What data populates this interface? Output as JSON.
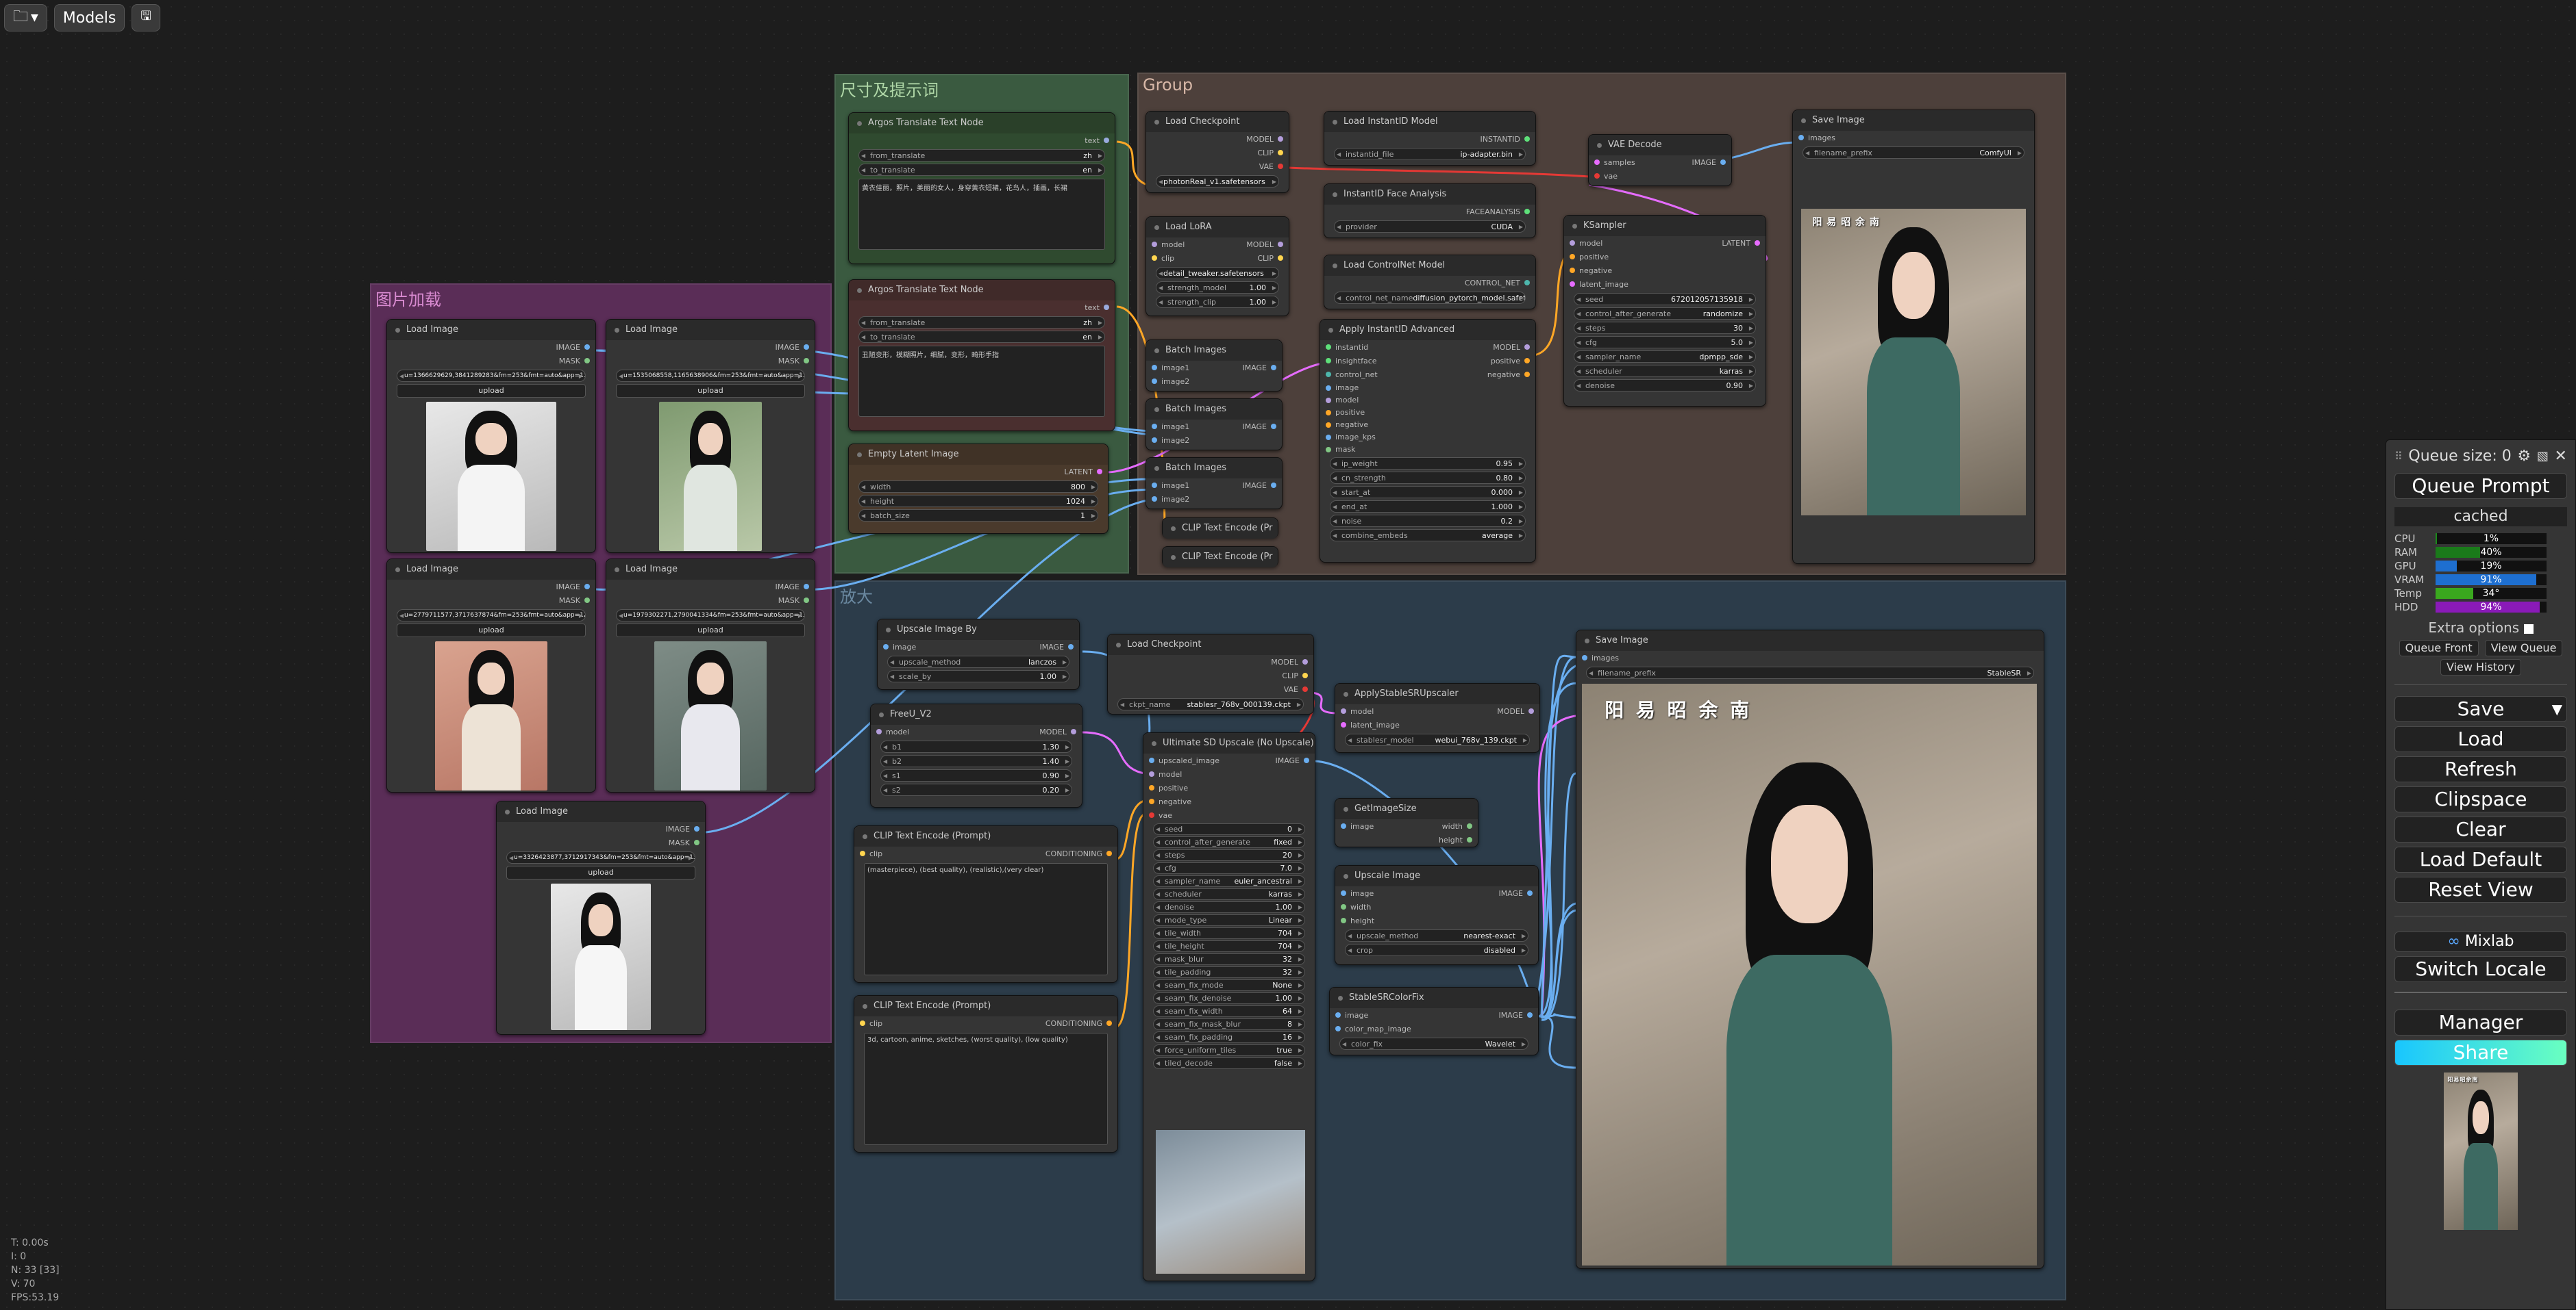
{
  "toolbar": {
    "models_label": "Models"
  },
  "groups": {
    "size_prompt": "尺寸及提示词",
    "group": "Group",
    "image_load": "图片加载",
    "upscale": "放大"
  },
  "nodes": {
    "translate1": {
      "title": "Argos Translate Text Node",
      "out": "text",
      "from_label": "from_translate",
      "from_value": "zh",
      "to_label": "to_translate",
      "to_value": "en",
      "text": "黄衣佳丽，照片，美丽的女人，身穿黄衣短裙，花鸟人，插画，长裙"
    },
    "translate2": {
      "title": "Argos Translate Text Node",
      "out": "text",
      "from_label": "from_translate",
      "from_value": "zh",
      "to_label": "to_translate",
      "to_value": "en",
      "text": "丑陋变形，模糊照片，细腻，变形，畸形手指"
    },
    "latent": {
      "title": "Empty Latent Image",
      "out": "LATENT",
      "w_label": "width",
      "w_value": "800",
      "h_label": "height",
      "h_value": "1024",
      "b_label": "batch_size",
      "b_value": "1"
    },
    "ckpt1": {
      "title": "Load Checkpoint",
      "o1": "MODEL",
      "o2": "CLIP",
      "o3": "VAE",
      "ck_label": "ckpt_name",
      "ck_value": "photonReal_v1.safetensors"
    },
    "lora": {
      "title": "Load LoRA",
      "i1": "model",
      "i2": "clip",
      "o1": "MODEL",
      "o2": "CLIP",
      "l_label": "lora_name",
      "l_value": "detail_tweaker.safetensors",
      "sm_label": "strength_model",
      "sm_value": "1.00",
      "sc_label": "strength_clip",
      "sc_value": "1.00"
    },
    "batch1": {
      "title": "Batch Images",
      "i1": "image1",
      "i2": "image2",
      "out": "IMAGE"
    },
    "batch2": {
      "title": "Batch Images",
      "i1": "image1",
      "i2": "image2",
      "out": "IMAGE"
    },
    "batch3": {
      "title": "Batch Images",
      "i1": "image1",
      "i2": "image2",
      "out": "IMAGE"
    },
    "clipenc1": {
      "title": "CLIP Text Encode (Pr"
    },
    "clipenc2": {
      "title": "CLIP Text Encode (Pr"
    },
    "instantid": {
      "title": "Load InstantID Model",
      "out": "INSTANTID",
      "f_label": "instantid_file",
      "f_value": "ip-adapter.bin"
    },
    "faceanalysis": {
      "title": "InstantID Face Analysis",
      "out": "FACEANALYSIS",
      "p_label": "provider",
      "p_value": "CUDA"
    },
    "controlnet": {
      "title": "Load ControlNet Model",
      "out": "CONTROL_NET",
      "c_label": "control_net_name",
      "c_value": "diffusion_pytorch_model.safetensors"
    },
    "applyid": {
      "title": "Apply InstantID Advanced",
      "inputs": [
        "instantid",
        "insightface",
        "control_net",
        "image",
        "model",
        "positive",
        "negative",
        "image_kps",
        "mask"
      ],
      "outputs": [
        "MODEL",
        "positive",
        "negative"
      ],
      "w1_label": "ip_weight",
      "w1_value": "0.95",
      "w2_label": "cn_strength",
      "w2_value": "0.80",
      "w3_label": "start_at",
      "w3_value": "0.000",
      "w4_label": "end_at",
      "w4_value": "1.000",
      "w5_label": "noise",
      "w5_value": "0.2",
      "w6_label": "combine_embeds",
      "w6_value": "average"
    },
    "vaedecode": {
      "title": "VAE Decode",
      "i1": "samples",
      "i2": "vae",
      "out": "IMAGE"
    },
    "ksampler": {
      "title": "KSampler",
      "inputs": [
        "model",
        "positive",
        "negative",
        "latent_image"
      ],
      "out": "LATENT",
      "w1_label": "seed",
      "w1_value": "672012057135918",
      "w2_label": "control_after_generate",
      "w2_value": "randomize",
      "w3_label": "steps",
      "w3_value": "30",
      "w4_label": "cfg",
      "w4_value": "5.0",
      "w5_label": "sampler_name",
      "w5_value": "dpmpp_sde",
      "w6_label": "scheduler",
      "w6_value": "karras",
      "w7_label": "denoise",
      "w7_value": "0.90"
    },
    "save1": {
      "title": "Save Image",
      "in": "images",
      "p_label": "filename_prefix",
      "p_value": "ComfyUI",
      "caption": "阳 易 昭 余 南"
    },
    "loadimg1": {
      "title": "Load Image",
      "o1": "IMAGE",
      "o2": "MASK",
      "file": "u=1366629629,3841289283&fm=253&fmt=auto&app=138&f=JPEG.webp",
      "upload": "upload"
    },
    "loadimg2": {
      "title": "Load Image",
      "o1": "IMAGE",
      "o2": "MASK",
      "file": "u=1535068558,1165638906&fm=253&fmt=auto&app=138&f=JPEG.webp",
      "upload": "upload"
    },
    "loadimg3": {
      "title": "Load Image",
      "o1": "IMAGE",
      "o2": "MASK",
      "file": "u=2779711577,3717637874&fm=253&fmt=auto&app=120&f=JPEG.webp",
      "upload": "upload"
    },
    "loadimg4": {
      "title": "Load Image",
      "o1": "IMAGE",
      "o2": "MASK",
      "file": "u=1979302271,2790041334&fm=253&fmt=auto&app=138&f=JPEG.webp",
      "upload": "upload"
    },
    "loadimg5": {
      "title": "Load Image",
      "o1": "IMAGE",
      "o2": "MASK",
      "file": "u=3326423877,3712917343&fm=253&fmt=auto&app=138&f=JPEG.webp",
      "upload": "upload"
    },
    "upscaleby": {
      "title": "Upscale Image By",
      "in": "image",
      "out": "IMAGE",
      "m_label": "upscale_method",
      "m_value": "lanczos",
      "s_label": "scale_by",
      "s_value": "1.00"
    },
    "freeu": {
      "title": "FreeU_V2",
      "in": "model",
      "out": "MODEL",
      "b1_label": "b1",
      "b1_value": "1.30",
      "b2_label": "b2",
      "b2_value": "1.40",
      "s1_label": "s1",
      "s1_value": "0.90",
      "s2_label": "s2",
      "s2_value": "0.20"
    },
    "ckpt2": {
      "title": "Load Checkpoint",
      "o1": "MODEL",
      "o2": "CLIP",
      "o3": "VAE",
      "ck_label": "ckpt_name",
      "ck_value": "stablesr_768v_000139.ckpt"
    },
    "stablesr": {
      "title": "ApplyStableSRUpscaler",
      "i1": "model",
      "i2": "latent_image",
      "out": "MODEL",
      "m_label": "stablesr_model",
      "m_value": "webui_768v_139.ckpt"
    },
    "usdu": {
      "title": "Ultimate SD Upscale (No Upscale)",
      "inputs": [
        "upscaled_image",
        "model",
        "positive",
        "negative",
        "vae"
      ],
      "out": "IMAGE",
      "widgets": [
        [
          "seed",
          "0"
        ],
        [
          "control_after_generate",
          "fixed"
        ],
        [
          "steps",
          "20"
        ],
        [
          "cfg",
          "7.0"
        ],
        [
          "sampler_name",
          "euler_ancestral"
        ],
        [
          "scheduler",
          "karras"
        ],
        [
          "denoise",
          "1.00"
        ],
        [
          "mode_type",
          "Linear"
        ],
        [
          "tile_width",
          "704"
        ],
        [
          "tile_height",
          "704"
        ],
        [
          "mask_blur",
          "32"
        ],
        [
          "tile_padding",
          "32"
        ],
        [
          "seam_fix_mode",
          "None"
        ],
        [
          "seam_fix_denoise",
          "1.00"
        ],
        [
          "seam_fix_width",
          "64"
        ],
        [
          "seam_fix_mask_blur",
          "8"
        ],
        [
          "seam_fix_padding",
          "16"
        ],
        [
          "force_uniform_tiles",
          "true"
        ],
        [
          "tiled_decode",
          "false"
        ]
      ]
    },
    "getsize": {
      "title": "GetImageSize",
      "in": "image",
      "o1": "width",
      "o2": "height"
    },
    "upscaleimg": {
      "title": "Upscale Image",
      "inputs": [
        "image",
        "width",
        "height"
      ],
      "out": "IMAGE",
      "m_label": "upscale_method",
      "m_value": "nearest-exact",
      "c_label": "crop",
      "c_value": "disabled"
    },
    "colorfix": {
      "title": "StableSRColorFix",
      "i1": "image",
      "i2": "color_map_image",
      "out": "IMAGE",
      "c_label": "color_fix",
      "c_value": "Wavelet"
    },
    "clipp1": {
      "title": "CLIP Text Encode (Prompt)",
      "in": "clip",
      "out": "CONDITIONING",
      "text": "(masterpiece), (best quality), (realistic),(very clear)"
    },
    "clipp2": {
      "title": "CLIP Text Encode (Prompt)",
      "in": "clip",
      "out": "CONDITIONING",
      "text": "3d, cartoon, anime, sketches, (worst quality), (low quality)"
    },
    "save2": {
      "title": "Save Image",
      "in": "images",
      "p_label": "filename_prefix",
      "p_value": "StableSR",
      "caption": "阳 易 昭 余 南"
    }
  },
  "sidebar": {
    "queue_size": "Queue size: 0",
    "queue_prompt": "Queue Prompt",
    "cached": "cached",
    "stats": [
      {
        "name": "CPU",
        "value": "1%",
        "pct": 1,
        "color": "#1a8a1a"
      },
      {
        "name": "RAM",
        "value": "40%",
        "pct": 40,
        "color": "#1a7a1a"
      },
      {
        "name": "GPU",
        "value": "19%",
        "pct": 19,
        "color": "#1e6fd0"
      },
      {
        "name": "VRAM",
        "value": "91%",
        "pct": 91,
        "color": "#1e6fd0"
      },
      {
        "name": "Temp",
        "value": "34°",
        "pct": 34,
        "color": "#3aa81e"
      },
      {
        "name": "HDD",
        "value": "94%",
        "pct": 94,
        "color": "#8a1ab8"
      }
    ],
    "extra_options": "Extra options",
    "queue_front": "Queue Front",
    "view_queue": "View Queue",
    "view_history": "View History",
    "save": "Save",
    "load": "Load",
    "refresh": "Refresh",
    "clipspace": "Clipspace",
    "clear": "Clear",
    "load_default": "Load Default",
    "reset_view": "Reset View",
    "mixlab": "Mixlab",
    "switch_locale": "Switch Locale",
    "manager": "Manager",
    "share": "Share",
    "mini_caption": "阳易昭余南"
  },
  "stats_info": {
    "t": "T: 0.00s",
    "i": "I: 0",
    "n": "N: 33 [33]",
    "v": "V: 70",
    "fps": "FPS:53.19"
  }
}
